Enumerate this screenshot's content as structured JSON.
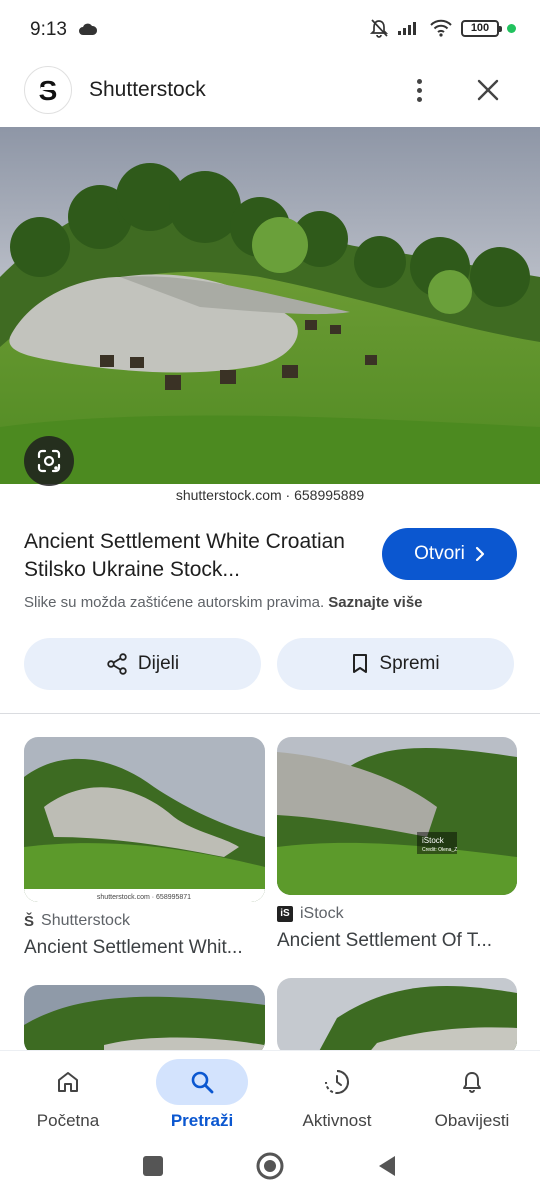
{
  "status": {
    "time": "9:13",
    "battery": "100"
  },
  "header": {
    "brand_name": "Shutterstock",
    "logo_glyph": "Š"
  },
  "hero": {
    "caption": "shutterstock.com · 658995889"
  },
  "result": {
    "title": "Ancient Settlement White Croatian Stilsko Ukraine Stock...",
    "open_label": "Otvori",
    "copyright_text": "Slike su možda zaštićene autorskim pravima.",
    "learn_more": "Saznajte više"
  },
  "actions": {
    "share_label": "Dijeli",
    "save_label": "Spremi"
  },
  "related": [
    {
      "source": "Shutterstock",
      "title": "Ancient Settlement Whit...",
      "img_caption": "shutterstock.com · 658995871"
    },
    {
      "source": "iStock",
      "title": "Ancient Settlement Of T...",
      "watermark": "iStock",
      "watermark_credit": "Credit: Olena_Z"
    }
  ],
  "nav": [
    {
      "label": "Početna",
      "icon": "home-icon"
    },
    {
      "label": "Pretraži",
      "icon": "search-icon"
    },
    {
      "label": "Aktivnost",
      "icon": "history-icon"
    },
    {
      "label": "Obavijesti",
      "icon": "bell-icon"
    }
  ],
  "colors": {
    "accent": "#0b57d0",
    "chip_bg": "#e8effa",
    "nav_active_bg": "#d3e3fd"
  }
}
